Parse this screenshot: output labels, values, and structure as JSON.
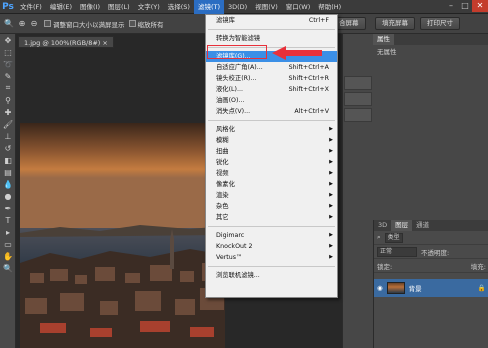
{
  "app": {
    "logo": "Ps"
  },
  "menubar": [
    {
      "id": "file",
      "label": "文件(F)"
    },
    {
      "id": "edit",
      "label": "编辑(E)"
    },
    {
      "id": "image",
      "label": "图像(I)"
    },
    {
      "id": "layer",
      "label": "图层(L)"
    },
    {
      "id": "type",
      "label": "文字(Y)"
    },
    {
      "id": "select",
      "label": "选择(S)"
    },
    {
      "id": "filter",
      "label": "滤镜(T)",
      "active": true
    },
    {
      "id": "3d",
      "label": "3D(D)"
    },
    {
      "id": "view",
      "label": "视图(V)"
    },
    {
      "id": "window",
      "label": "窗口(W)"
    },
    {
      "id": "help",
      "label": "帮助(H)"
    }
  ],
  "options": {
    "check1": "调整窗口大小以满屏显示",
    "check2": "缩放所有",
    "btn_fill": "填充屏幕",
    "btn_print": "打印尺寸",
    "btn_partial": "合屏幕"
  },
  "document": {
    "tab": "1.jpg @ 100%(RGB/8#)"
  },
  "properties": {
    "tab": "属性",
    "value": "无属性"
  },
  "layers": {
    "tabs": [
      "3D",
      "图层",
      "通道"
    ],
    "kind_label": "类型",
    "blend_mode": "正常",
    "opacity_label": "不透明度:",
    "lock_label": "锁定:",
    "fill_label": "填充:",
    "layer_name": "背景"
  },
  "filter_menu": [
    {
      "label": "滤镜库",
      "shortcut": "Ctrl+F"
    },
    {
      "sep": true
    },
    {
      "label": "转换为智能滤镜"
    },
    {
      "sep": true
    },
    {
      "label": "滤镜库(G)...",
      "highlight": true
    },
    {
      "label": "自适应广角(A)...",
      "shortcut": "Shift+Ctrl+A"
    },
    {
      "label": "镜头校正(R)...",
      "shortcut": "Shift+Ctrl+R"
    },
    {
      "label": "液化(L)...",
      "shortcut": "Shift+Ctrl+X"
    },
    {
      "label": "油画(O)..."
    },
    {
      "label": "消失点(V)...",
      "shortcut": "Alt+Ctrl+V"
    },
    {
      "sep": true
    },
    {
      "label": "风格化",
      "sub": true
    },
    {
      "label": "模糊",
      "sub": true
    },
    {
      "label": "扭曲",
      "sub": true
    },
    {
      "label": "锐化",
      "sub": true
    },
    {
      "label": "视频",
      "sub": true
    },
    {
      "label": "像素化",
      "sub": true
    },
    {
      "label": "渲染",
      "sub": true
    },
    {
      "label": "杂色",
      "sub": true
    },
    {
      "label": "其它",
      "sub": true
    },
    {
      "sep": true
    },
    {
      "label": "Digimarc",
      "sub": true
    },
    {
      "label": "KnockOut 2",
      "sub": true
    },
    {
      "label": "Vertus™",
      "sub": true
    },
    {
      "sep": true
    },
    {
      "label": "浏览联机滤镜..."
    }
  ],
  "colors": {
    "accent": "#3b8fe6",
    "highlight_box": "#e8303a"
  }
}
